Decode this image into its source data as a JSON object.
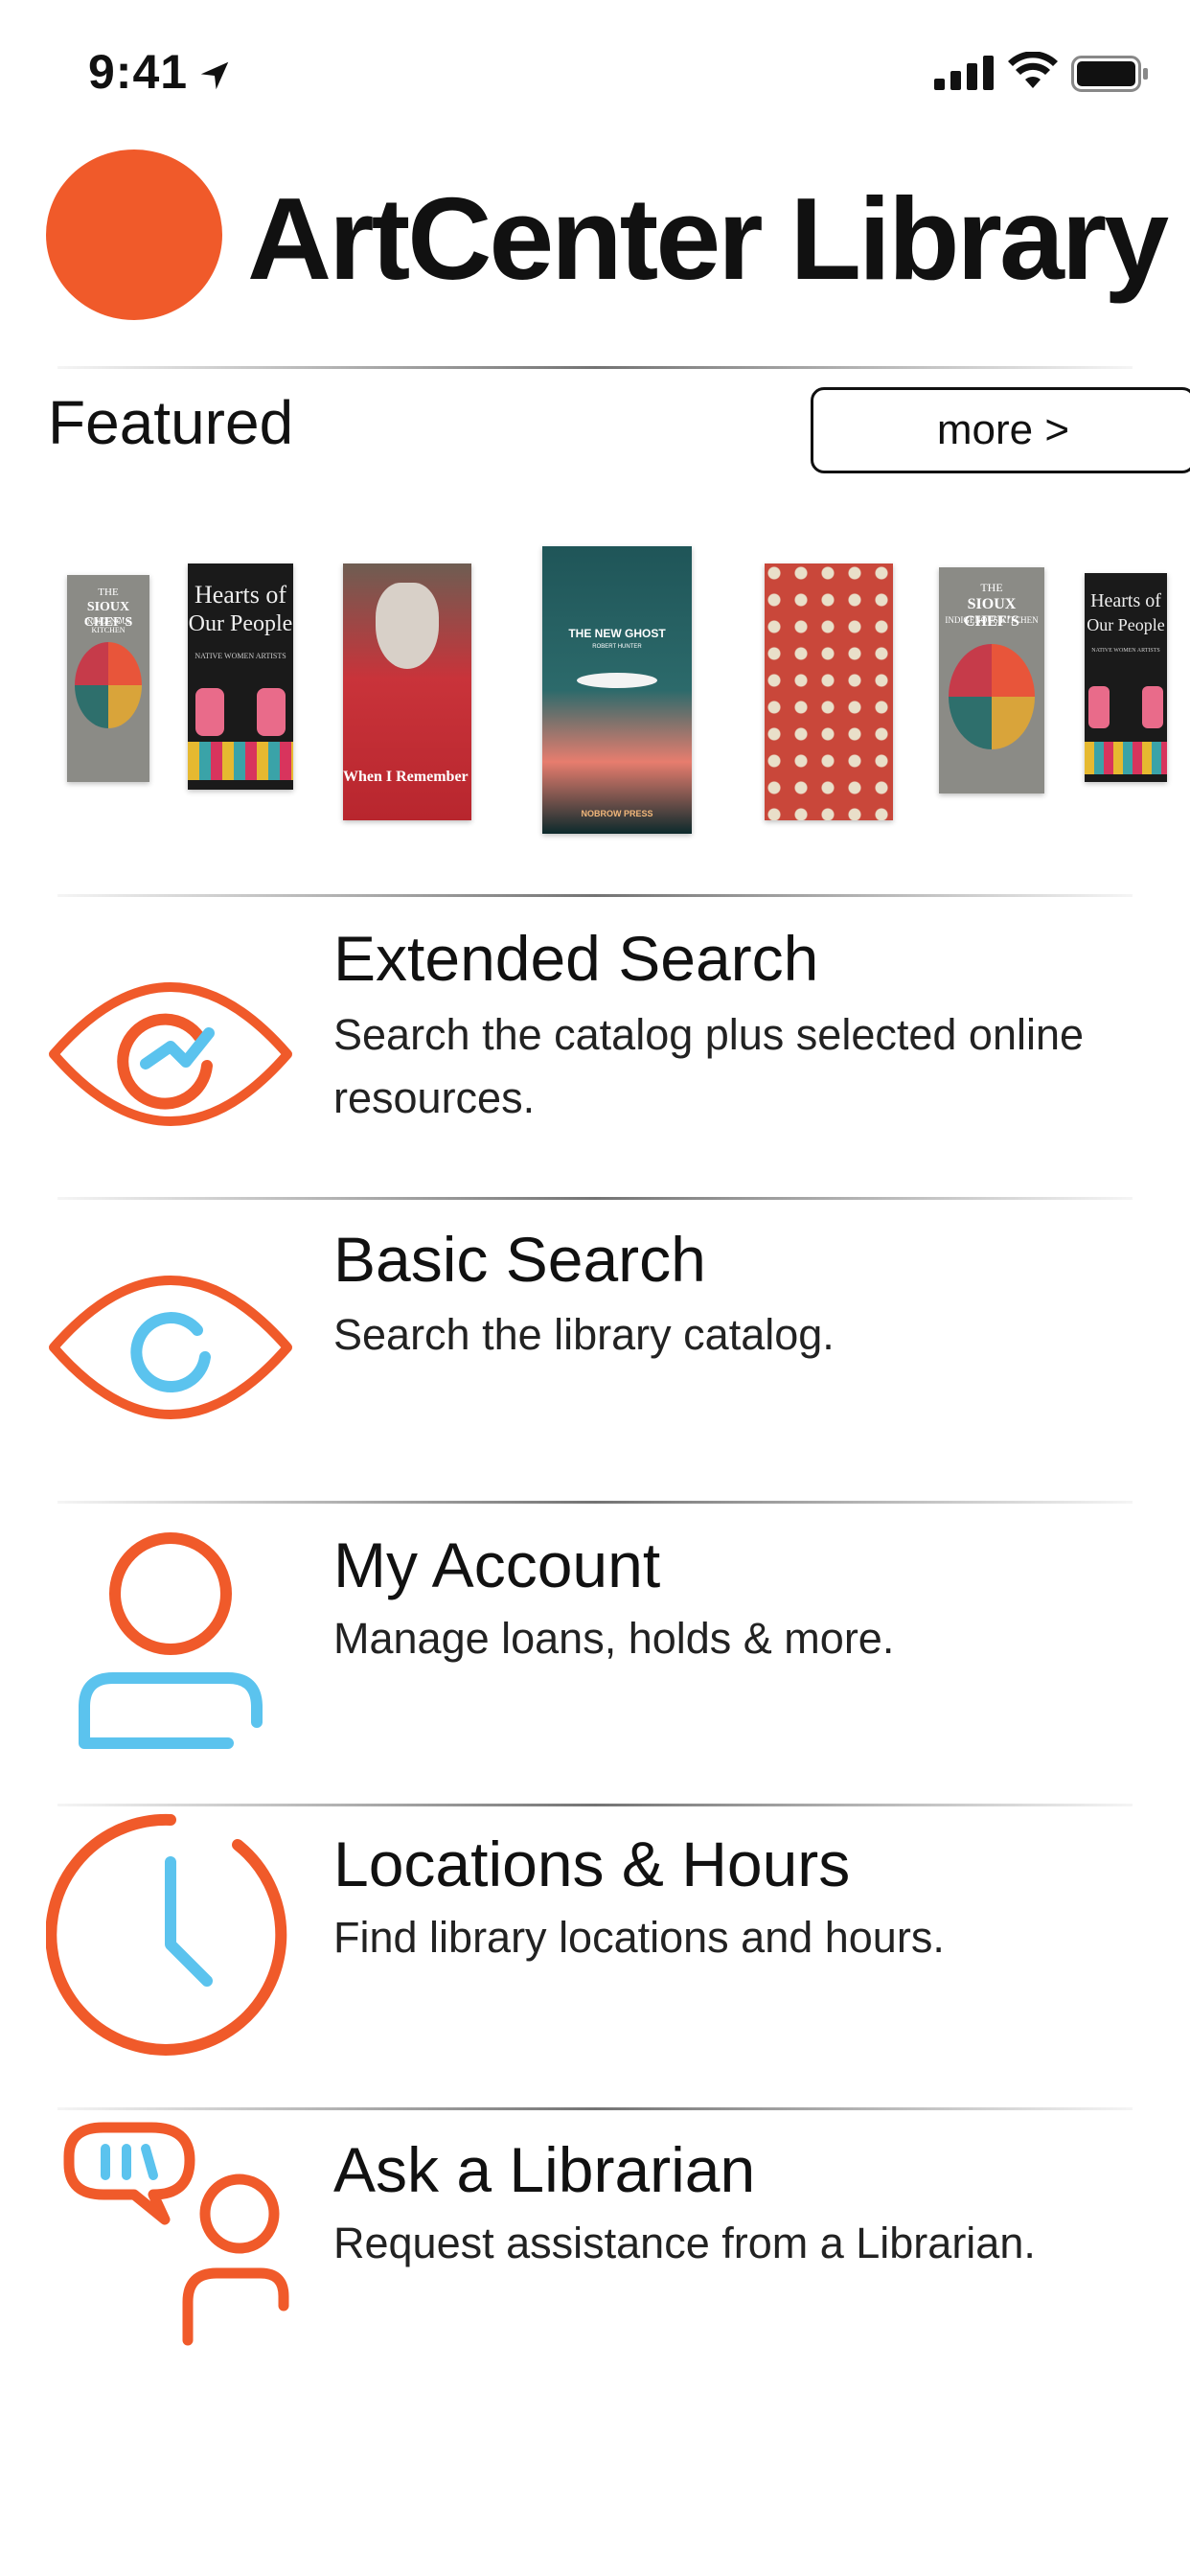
{
  "status_bar": {
    "time": "9:41",
    "icons": [
      "location-arrow-icon",
      "cellular-signal-icon",
      "wifi-icon",
      "battery-icon"
    ]
  },
  "header": {
    "logo_text": "ArtCenter Library",
    "brand_color": "#f05a2a"
  },
  "featured": {
    "title": "Featured",
    "more_label": "more >",
    "books": [
      {
        "title_line1": "THE",
        "title_line2": "SIOUX CHEF'S",
        "title_line3": "INDIGENOUS KITCHEN"
      },
      {
        "title_line1": "Hearts of",
        "title_line2": "Our People",
        "title_line3": "NATIVE WOMEN ARTISTS"
      },
      {
        "title_line1": "When I Remember I See Red"
      },
      {
        "title_line1": "THE NEW GHOST",
        "title_line2": "ROBERT HUNTER",
        "title_line3": "NOBROW PRESS"
      },
      {
        "title_line1": ""
      },
      {
        "title_line1": "THE",
        "title_line2": "SIOUX CHEF'S",
        "title_line3": "INDIGENOUS KITCHEN"
      },
      {
        "title_line1": "Hearts of",
        "title_line2": "Our People",
        "title_line3": "NATIVE WOMEN ARTISTS"
      }
    ]
  },
  "menu": {
    "accent_orange": "#f05a2a",
    "accent_blue": "#5bc3ee",
    "items": [
      {
        "title": "Extended Search",
        "description": "Search the catalog plus selected online resources.",
        "icon": "eye-graph-icon"
      },
      {
        "title": "Basic Search",
        "description": "Search the library catalog.",
        "icon": "eye-icon"
      },
      {
        "title": "My Account",
        "description": "Manage loans, holds & more.",
        "icon": "person-icon"
      },
      {
        "title": "Locations & Hours",
        "description": "Find library locations and hours.",
        "icon": "clock-icon"
      },
      {
        "title": "Ask a Librarian",
        "description": "Request assistance from a Librarian.",
        "icon": "librarian-chat-icon"
      }
    ]
  }
}
